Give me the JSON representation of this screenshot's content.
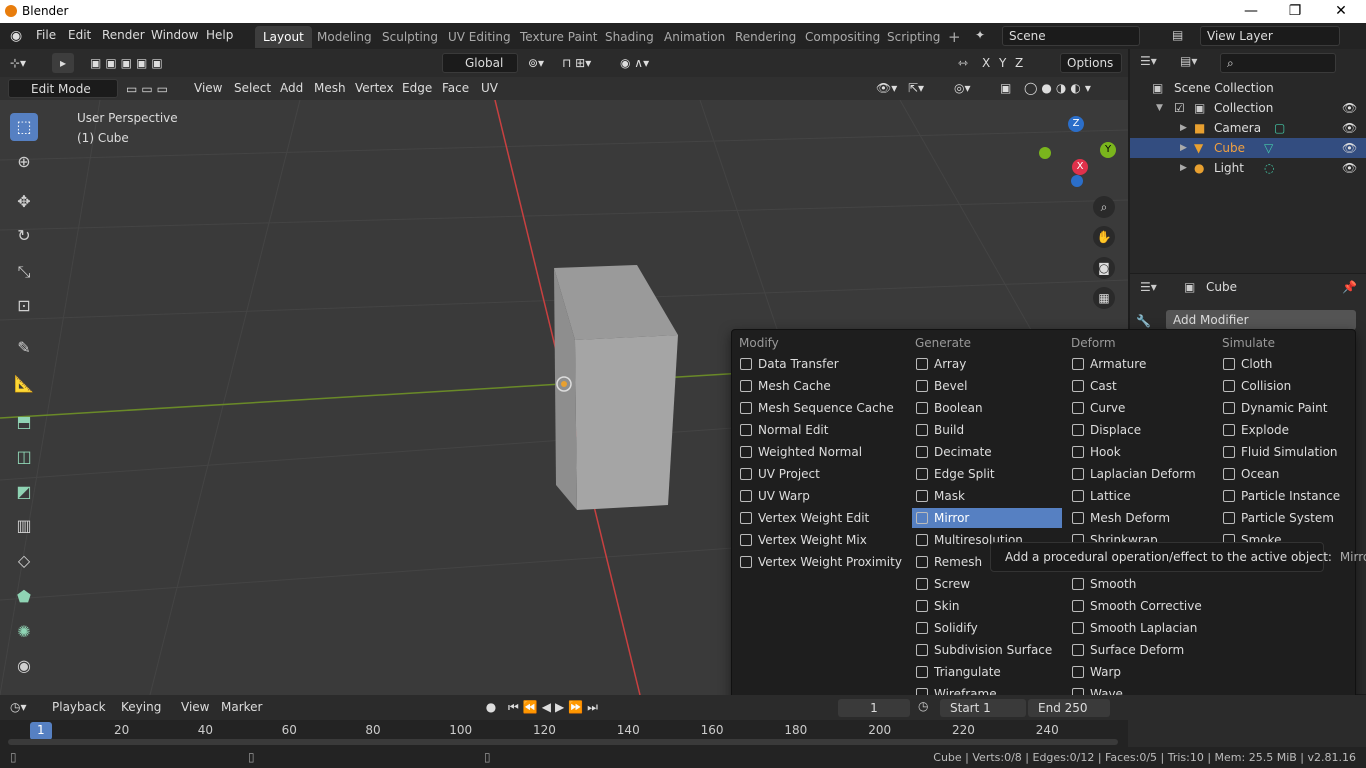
{
  "window": {
    "title": "Blender",
    "min": "—",
    "restore": "❐",
    "close": "✕"
  },
  "menus": [
    "File",
    "Edit",
    "Render",
    "Window",
    "Help"
  ],
  "workspaces": [
    "Layout",
    "Modeling",
    "Sculpting",
    "UV Editing",
    "Texture Paint",
    "Shading",
    "Animation",
    "Rendering",
    "Compositing",
    "Scripting"
  ],
  "add_tab": "+",
  "scene": {
    "name": "Scene",
    "view_layer": "View Layer"
  },
  "header": {
    "transform": "Global",
    "options": "Options",
    "axes": [
      "X",
      "Y",
      "Z"
    ]
  },
  "viewport_header": {
    "mode": "Edit Mode",
    "menus": [
      "View",
      "Select",
      "Add",
      "Mesh",
      "Vertex",
      "Edge",
      "Face",
      "UV"
    ]
  },
  "viewport": {
    "perspective": "User Perspective",
    "object": "(1) Cube",
    "gizmo": {
      "z": "Z",
      "y": "Y",
      "x": "X"
    }
  },
  "outliner": {
    "root": "Scene Collection",
    "collection": "Collection",
    "items": [
      "Camera",
      "Cube",
      "Light"
    ]
  },
  "properties": {
    "object": "Cube",
    "add_modifier": "Add Modifier"
  },
  "modifier_menu": {
    "columns": [
      {
        "title": "Modify",
        "items": [
          "Data Transfer",
          "Mesh Cache",
          "Mesh Sequence Cache",
          "Normal Edit",
          "Weighted Normal",
          "UV Project",
          "UV Warp",
          "Vertex Weight Edit",
          "Vertex Weight Mix",
          "Vertex Weight Proximity"
        ]
      },
      {
        "title": "Generate",
        "items": [
          "Array",
          "Bevel",
          "Boolean",
          "Build",
          "Decimate",
          "Edge Split",
          "Mask",
          "Mirror",
          "Multiresolution",
          "Remesh",
          "Screw",
          "Skin",
          "Solidify",
          "Subdivision Surface",
          "Triangulate",
          "Wireframe"
        ]
      },
      {
        "title": "Deform",
        "items": [
          "Armature",
          "Cast",
          "Curve",
          "Displace",
          "Hook",
          "Laplacian Deform",
          "Lattice",
          "Mesh Deform",
          "Shrinkwrap",
          "",
          "Smooth",
          "Smooth Corrective",
          "Smooth Laplacian",
          "Surface Deform",
          "Warp",
          "Wave"
        ]
      },
      {
        "title": "Simulate",
        "items": [
          "Cloth",
          "Collision",
          "Dynamic Paint",
          "Explode",
          "Fluid Simulation",
          "Ocean",
          "Particle Instance",
          "Particle System",
          "Smoke"
        ]
      }
    ],
    "highlighted": "Mirror"
  },
  "tooltip": {
    "text": "Add a procedural operation/effect to the active object:",
    "target": "Mirror"
  },
  "timeline": {
    "menus": [
      "Playback",
      "Keying",
      "View",
      "Marker"
    ],
    "ticks": [
      "1",
      "20",
      "40",
      "60",
      "80",
      "100",
      "120",
      "140",
      "160",
      "180",
      "200",
      "220",
      "240"
    ],
    "start_label": "Start",
    "start": "1",
    "end_label": "End",
    "end": "250",
    "current": "1"
  },
  "status": "Cube | Verts:0/8 | Edges:0/12 | Faces:0/5 | Tris:10 | Mem: 25.5 MiB | v2.81.16",
  "colors": {
    "accent": "#5680c2",
    "x_axis": "#e0314b",
    "y_axis": "#7ab51d",
    "z_axis": "#2b6ec9"
  }
}
